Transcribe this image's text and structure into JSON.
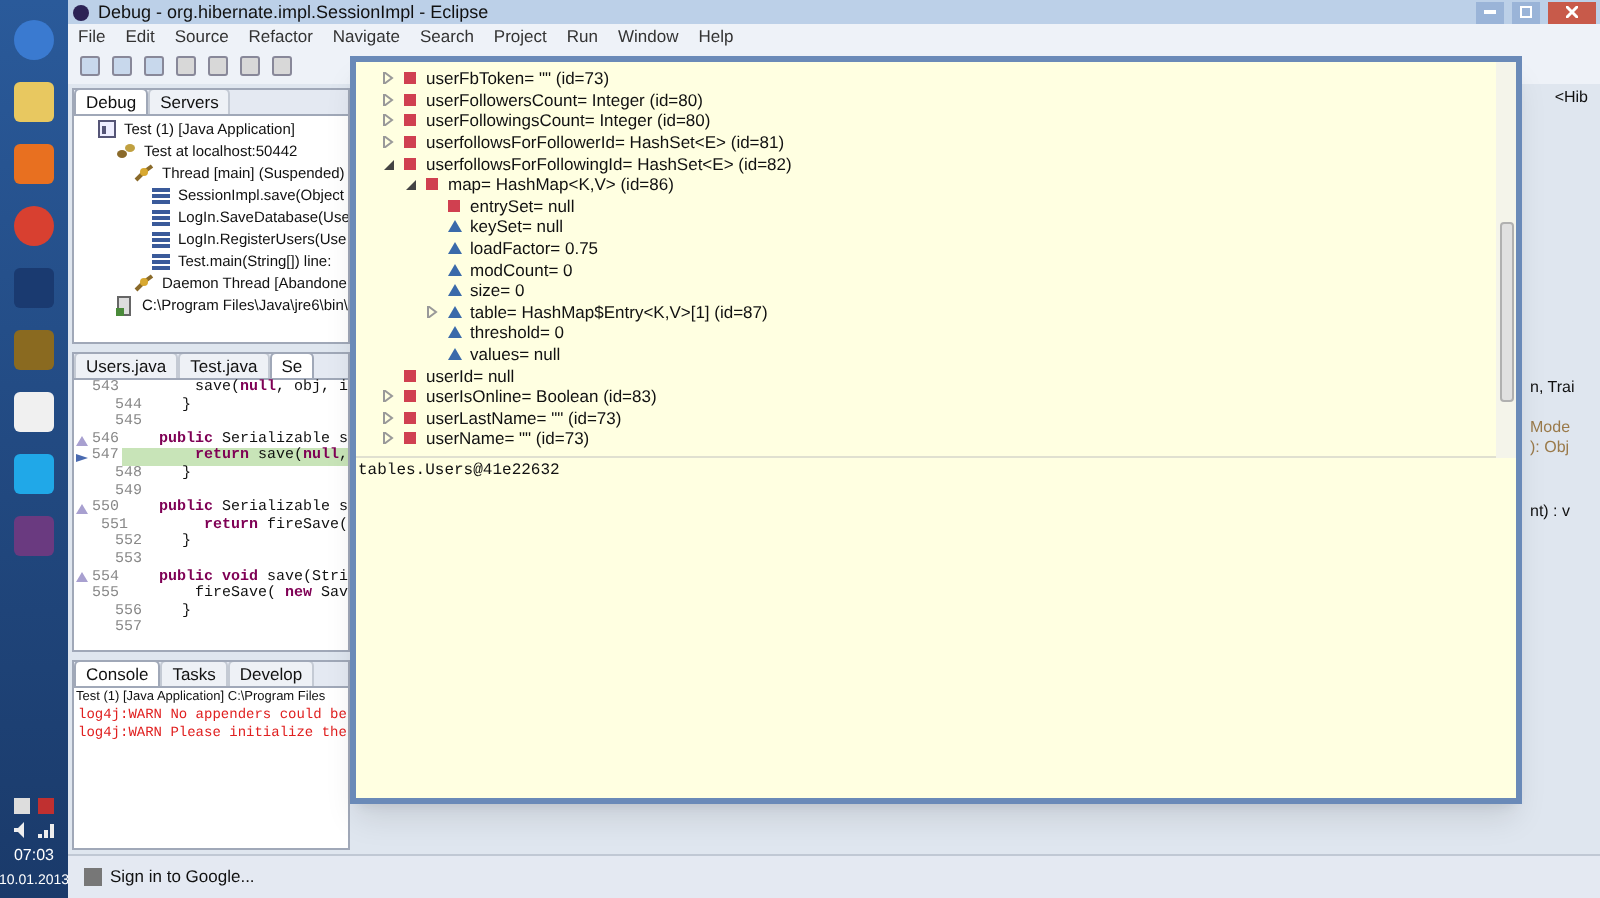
{
  "taskbar": {
    "clock": {
      "time": "07:03",
      "date": "10.01.2013"
    }
  },
  "window": {
    "title": "Debug - org.hibernate.impl.SessionImpl - Eclipse"
  },
  "menu": [
    "File",
    "Edit",
    "Source",
    "Refactor",
    "Navigate",
    "Search",
    "Project",
    "Run",
    "Window",
    "Help"
  ],
  "debug_view": {
    "tabs": [
      {
        "label": "Debug",
        "selected": true
      },
      {
        "label": "Servers",
        "selected": false
      }
    ],
    "tree": [
      {
        "label": "Test (1) [Java Application]",
        "kind": "launch",
        "children": [
          {
            "label": "Test at localhost:50442",
            "kind": "target",
            "children": [
              {
                "label": "Thread [main] (Suspended)",
                "kind": "thread",
                "children": [
                  {
                    "label": "SessionImpl.save(Object",
                    "kind": "frame"
                  },
                  {
                    "label": "LogIn.SaveDatabase(Use",
                    "kind": "frame"
                  },
                  {
                    "label": "LogIn.RegisterUsers(Use",
                    "kind": "frame"
                  },
                  {
                    "label": "Test.main(String[]) line:",
                    "kind": "frame"
                  }
                ]
              },
              {
                "label": "Daemon Thread [Abandone",
                "kind": "thread"
              }
            ]
          },
          {
            "label": "C:\\Program Files\\Java\\jre6\\bin\\",
            "kind": "process"
          }
        ]
      }
    ]
  },
  "editor": {
    "tabs": [
      {
        "label": "Users.java",
        "selected": false
      },
      {
        "label": "Test.java",
        "selected": false
      },
      {
        "label": "Se",
        "selected": true
      }
    ],
    "lines": [
      {
        "number": "543",
        "parts": [
          {
            "text": "        save(",
            "kind": "plain"
          },
          {
            "text": "null",
            "kind": "keyword"
          },
          {
            "text": ", obj, i",
            "kind": "plain"
          }
        ]
      },
      {
        "number": "544",
        "parts": [
          {
            "text": "    }",
            "kind": "plain"
          }
        ]
      },
      {
        "number": "545"
      },
      {
        "number": "546",
        "override": true,
        "parts": [
          {
            "text": "    public",
            "kind": "keyword"
          },
          {
            "text": " Serializable s",
            "kind": "plain"
          }
        ]
      },
      {
        "number": "547",
        "current": true,
        "parts": [
          {
            "text": "        return",
            "kind": "keyword"
          },
          {
            "text": " save(",
            "kind": "plain"
          },
          {
            "text": "null",
            "kind": "keyword"
          },
          {
            "text": ",",
            "kind": "plain"
          }
        ]
      },
      {
        "number": "548",
        "parts": [
          {
            "text": "    }",
            "kind": "plain"
          }
        ]
      },
      {
        "number": "549"
      },
      {
        "number": "550",
        "override": true,
        "parts": [
          {
            "text": "    public",
            "kind": "keyword"
          },
          {
            "text": " Serializable s",
            "kind": "plain"
          }
        ]
      },
      {
        "number": "551",
        "parts": [
          {
            "text": "        return",
            "kind": "keyword"
          },
          {
            "text": " fireSave(",
            "kind": "plain"
          }
        ]
      },
      {
        "number": "552",
        "parts": [
          {
            "text": "    }",
            "kind": "plain"
          }
        ]
      },
      {
        "number": "553"
      },
      {
        "number": "554",
        "override": true,
        "parts": [
          {
            "text": "    public void",
            "kind": "keyword"
          },
          {
            "text": " save(Stri",
            "kind": "plain"
          }
        ]
      },
      {
        "number": "555",
        "parts": [
          {
            "text": "        fireSave( ",
            "kind": "plain"
          },
          {
            "text": "new",
            "kind": "keyword"
          },
          {
            "text": " Sav",
            "kind": "plain"
          }
        ]
      },
      {
        "number": "556",
        "parts": [
          {
            "text": "    }",
            "kind": "plain"
          }
        ]
      },
      {
        "number": "557"
      }
    ]
  },
  "console": {
    "tabs": [
      {
        "label": "Console",
        "selected": true
      },
      {
        "label": "Tasks",
        "selected": false
      },
      {
        "label": "Develop",
        "selected": false
      }
    ],
    "header": "Test (1) [Java Application] C:\\Program Files",
    "lines": [
      "log4j:WARN No appenders could be",
      "log4j:WARN Please initialize the"
    ]
  },
  "right_fragments": [
    "<Hib",
    "n, Trai",
    "Mode",
    "): Obj",
    "nt) : v"
  ],
  "status_bar": {
    "text": "Sign in to Google..."
  },
  "inspect_popup": {
    "variables": [
      {
        "label": "userFbToken= \"\" (id=73)",
        "kind": "private",
        "expanded": false
      },
      {
        "label": "userFollowersCount= Integer  (id=80)",
        "kind": "private",
        "expanded": false
      },
      {
        "label": "userFollowingsCount= Integer  (id=80)",
        "kind": "private",
        "expanded": false
      },
      {
        "label": "userfollowsForFollowerId= HashSet<E>  (id=81)",
        "kind": "private",
        "expanded": false
      },
      {
        "label": "userfollowsForFollowingId= HashSet<E>  (id=82)",
        "kind": "private",
        "expanded": true,
        "children": [
          {
            "label": "map= HashMap<K,V>  (id=86)",
            "kind": "private",
            "expanded": true,
            "children": [
              {
                "label": "entrySet= null",
                "kind": "private"
              },
              {
                "label": "keySet= null",
                "kind": "default"
              },
              {
                "label": "loadFactor= 0.75",
                "kind": "default"
              },
              {
                "label": "modCount= 0",
                "kind": "default"
              },
              {
                "label": "size= 0",
                "kind": "default"
              },
              {
                "label": "table= HashMap$Entry<K,V>[1]  (id=87)",
                "kind": "default",
                "expanded": false
              },
              {
                "label": "threshold= 0",
                "kind": "default"
              },
              {
                "label": "values= null",
                "kind": "default"
              }
            ]
          }
        ]
      },
      {
        "label": "userId= null",
        "kind": "private"
      },
      {
        "label": "userIsOnline= Boolean  (id=83)",
        "kind": "private",
        "expanded": false
      },
      {
        "label": "userLastName= \"\" (id=73)",
        "kind": "private",
        "expanded": false
      },
      {
        "label": "userName= \"\" (id=73)",
        "kind": "private",
        "expanded": false
      }
    ],
    "detail": "tables.Users@41e22632"
  }
}
